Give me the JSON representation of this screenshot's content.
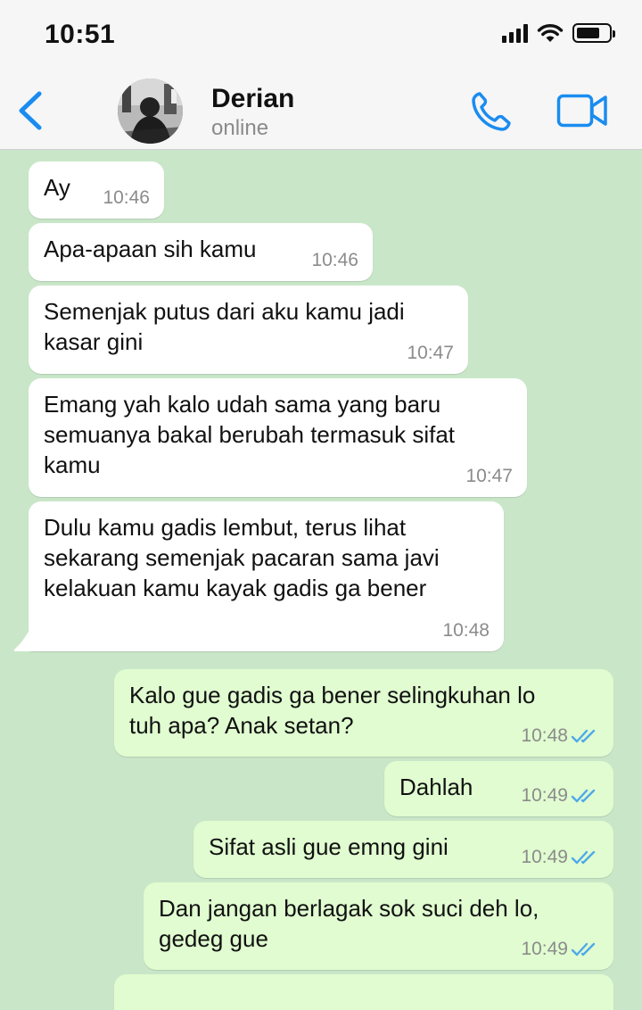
{
  "status_bar": {
    "time": "10:51"
  },
  "header": {
    "contact_name": "Derian",
    "contact_status": "online"
  },
  "messages": [
    {
      "dir": "in",
      "text": "Ay",
      "time": "10:46"
    },
    {
      "dir": "in",
      "text": "Apa-apaan sih kamu",
      "time": "10:46"
    },
    {
      "dir": "in",
      "text": "Semenjak putus dari aku kamu jadi\nkasar gini",
      "time": "10:47"
    },
    {
      "dir": "in",
      "text": "Emang yah kalo udah sama yang baru\nsemuanya bakal berubah termasuk sifat\nkamu",
      "time": "10:47"
    },
    {
      "dir": "in",
      "text": "Dulu kamu gadis lembut, terus lihat\nsekarang semenjak pacaran sama javi\nkelakuan kamu kayak gadis ga bener",
      "time": "10:48"
    },
    {
      "dir": "out",
      "text": "Kalo gue gadis ga bener selingkuhan lo\ntuh apa? Anak setan?",
      "time": "10:48",
      "read": true
    },
    {
      "dir": "out",
      "text": "Dahlah",
      "time": "10:49",
      "read": true
    },
    {
      "dir": "out",
      "text": "Sifat asli gue emng gini",
      "time": "10:49",
      "read": true
    },
    {
      "dir": "out",
      "text": "Dan jangan berlagak sok suci deh lo,\ngedeg gue",
      "time": "10:49",
      "read": true
    }
  ],
  "colors": {
    "accent": "#1a8cf0",
    "chat_background": "#c9e7c8",
    "incoming_bubble": "#ffffff",
    "outgoing_bubble": "#e0fcd0",
    "read_ticks": "#4fa9e9"
  },
  "icons": [
    "back-chevron-icon",
    "phone-icon",
    "video-camera-icon",
    "double-check-icon",
    "signal-icon",
    "wifi-icon",
    "battery-icon"
  ]
}
